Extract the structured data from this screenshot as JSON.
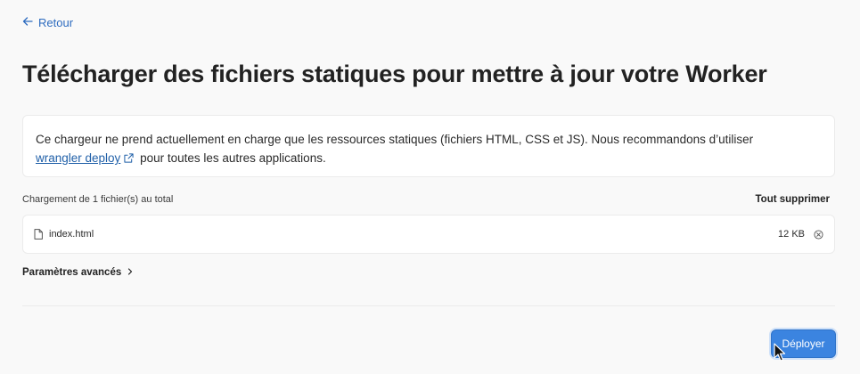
{
  "nav": {
    "back_label": "Retour"
  },
  "header": {
    "title": "Télécharger des fichiers statiques pour mettre à jour votre Worker"
  },
  "info": {
    "text_before": "Ce chargeur ne prend actuellement en charge que les ressources statiques (fichiers HTML, CSS et JS). Nous recommandons d’utiliser",
    "link_label": "wrangler deploy",
    "text_after": "pour toutes les autres applications."
  },
  "upload": {
    "summary": "Chargement de 1 fichier(s) au total",
    "delete_all_label": "Tout supprimer",
    "files": [
      {
        "name": "index.html",
        "size": "12 KB"
      }
    ]
  },
  "advanced": {
    "label": "Paramètres avancés"
  },
  "footer": {
    "deploy_label": "Déployer"
  },
  "colors": {
    "accent": "#3b84e0",
    "link": "#2d6bbf",
    "background": "#f9f9f9"
  },
  "icons": {
    "back": "arrow-left-icon",
    "external": "external-link-icon",
    "file": "file-icon",
    "remove": "close-circle-icon",
    "chevron": "chevron-right-icon"
  }
}
